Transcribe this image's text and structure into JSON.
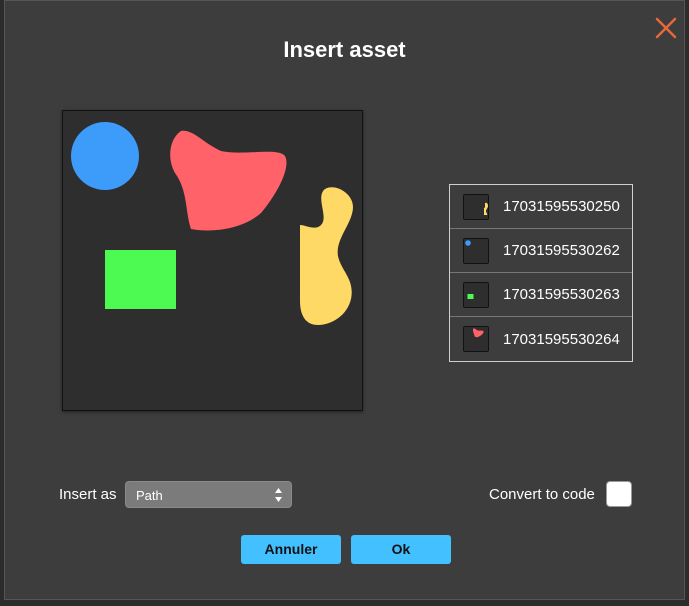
{
  "dialog": {
    "title": "Insert asset"
  },
  "preview": {
    "background": "#2e2e2e",
    "shapes": [
      {
        "kind": "circle",
        "color": "#3d9bf9"
      },
      {
        "kind": "blob",
        "color": "#ff6268"
      },
      {
        "kind": "rectangle",
        "color": "#4dfa52"
      },
      {
        "kind": "blob",
        "color": "#ffd966"
      }
    ]
  },
  "assets": [
    {
      "label": "17031595530250",
      "thumb_color": "#ffd966"
    },
    {
      "label": "17031595530262",
      "thumb_color": "#3d9bf9"
    },
    {
      "label": "17031595530263",
      "thumb_color": "#4dfa52"
    },
    {
      "label": "17031595530264",
      "thumb_color": "#ff6268"
    }
  ],
  "insert_as": {
    "label": "Insert as",
    "selected": "Path"
  },
  "convert": {
    "label": "Convert to code",
    "checked": false
  },
  "buttons": {
    "cancel": "Annuler",
    "ok": "Ok"
  },
  "colors": {
    "accent": "#43c0ff",
    "close": "#e8673a",
    "dialog_bg": "#3d3d3d"
  }
}
